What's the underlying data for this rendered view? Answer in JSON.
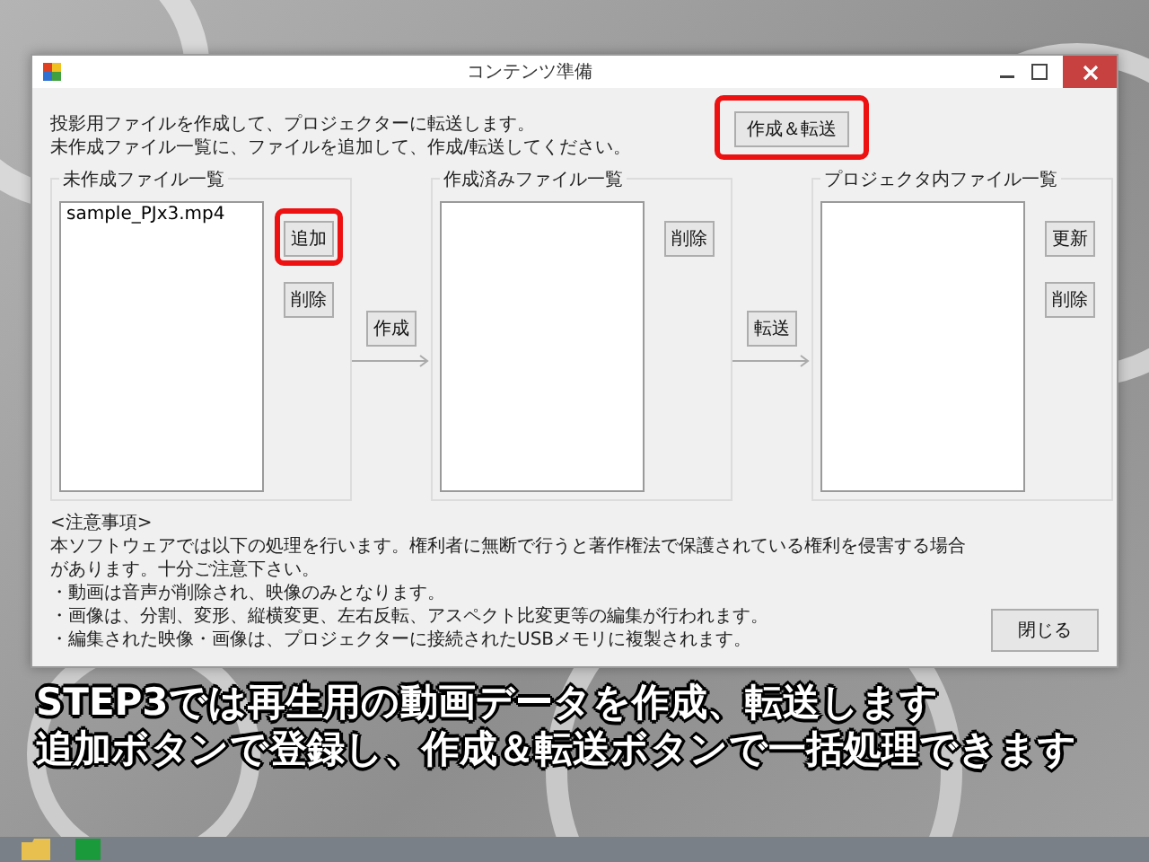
{
  "window": {
    "title": "コンテンツ準備",
    "intro": [
      "投影用ファイルを作成して、プロジェクターに転送します。",
      "未作成ファイル一覧に、ファイルを追加して、作成/転送してください。"
    ],
    "create_transfer_button": {
      "label": "作成＆転送",
      "highlighted": true
    },
    "panels": [
      {
        "label": "未作成ファイル一覧",
        "items": [
          "sample_PJx3.mp4"
        ],
        "buttons": [
          {
            "label": "追加",
            "highlighted": true
          },
          {
            "label": "削除",
            "highlighted": false
          }
        ],
        "next_button": {
          "label": "作成"
        }
      },
      {
        "label": "作成済みファイル一覧",
        "buttons": [
          {
            "label": "削除",
            "highlighted": false
          }
        ],
        "next_button": {
          "label": "転送"
        }
      },
      {
        "label": "プロジェクタ内ファイル一覧",
        "buttons": [
          {
            "label": "更新",
            "highlighted": false
          },
          {
            "label": "削除",
            "highlighted": false
          }
        ]
      }
    ],
    "notes": {
      "heading": "<注意事項>",
      "lines": [
        "本ソフトウェアでは以下の処理を行います。権利者に無断で行うと著作権法で保護されている権利を侵害する場合があります。十分ご注意下さい。",
        "・動画は音声が削除され、映像のみとなります。",
        "・画像は、分割、変形、縦横変更、左右反転、アスペクト比変更等の編集が行われます。",
        "・編集された映像・画像は、プロジェクターに接続されたUSBメモリに複製されます。"
      ]
    },
    "close_button": {
      "label": "閉じる"
    }
  },
  "caption": [
    "STEP3では再生用の動画データを作成、転送します",
    "追加ボタンで登録し、作成＆転送ボタンで一括処理できます"
  ]
}
